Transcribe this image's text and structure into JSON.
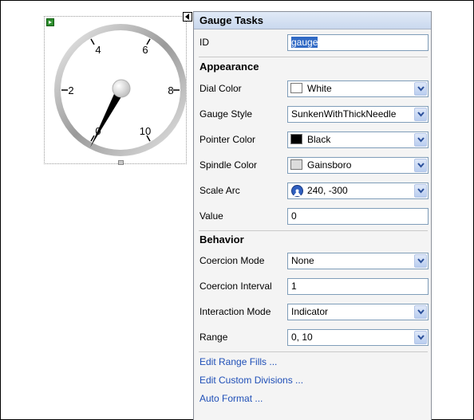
{
  "gauge": {
    "scale_labels": [
      "0",
      "2",
      "4",
      "6",
      "8",
      "10"
    ],
    "value": 0,
    "scale_arc": "240, -300",
    "dial_color": "#ffffff",
    "pointer_color": "#000000",
    "spindle_color": "#dcdcdc"
  },
  "panel": {
    "title": "Gauge Tasks",
    "id_label": "ID",
    "id_value": "gauge",
    "appearance_header": "Appearance",
    "behavior_header": "Behavior",
    "appearance": [
      {
        "label": "Dial Color",
        "value": "White",
        "swatch": "#ffffff"
      },
      {
        "label": "Gauge Style",
        "value": "SunkenWithThickNeedle"
      },
      {
        "label": "Pointer Color",
        "value": "Black",
        "swatch": "#000000"
      },
      {
        "label": "Spindle Color",
        "value": "Gainsboro",
        "swatch": "#dcdcdc"
      },
      {
        "label": "Scale Arc",
        "value": "240, -300",
        "icon": "scale-arc-icon"
      },
      {
        "label": "Value",
        "value": "0"
      }
    ],
    "behavior": [
      {
        "label": "Coercion Mode",
        "value": "None"
      },
      {
        "label": "Coercion Interval",
        "value": "1"
      },
      {
        "label": "Interaction Mode",
        "value": "Indicator"
      },
      {
        "label": "Range",
        "value": "0, 10"
      }
    ],
    "links": [
      "Edit Range Fills ...",
      "Edit Custom Divisions ...",
      "Auto Format ..."
    ]
  }
}
